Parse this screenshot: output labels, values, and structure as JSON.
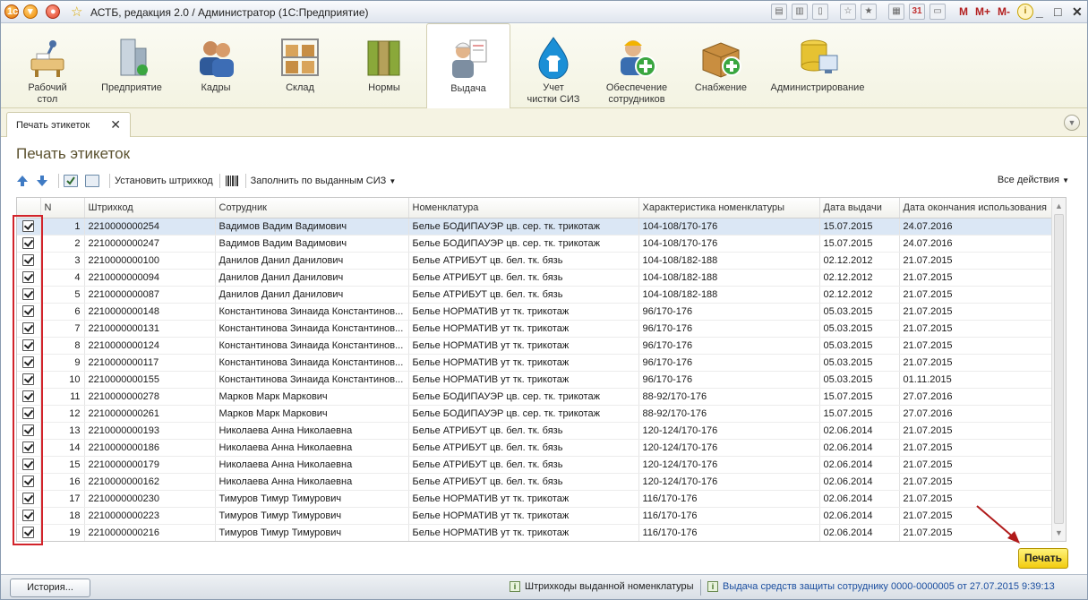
{
  "window": {
    "title": "АСТБ, редакция 2.0 / Администратор  (1С:Предприятие)",
    "toolbar_memory": [
      "M",
      "M+",
      "M-"
    ]
  },
  "sections": [
    {
      "label": "Рабочий\nстол",
      "icon": "desktop-icon"
    },
    {
      "label": "Предприятие",
      "icon": "enterprise-icon"
    },
    {
      "label": "Кадры",
      "icon": "staff-icon"
    },
    {
      "label": "Склад",
      "icon": "warehouse-icon"
    },
    {
      "label": "Нормы",
      "icon": "norms-icon"
    },
    {
      "label": "Выдача",
      "icon": "issue-icon",
      "active": true
    },
    {
      "label": "Учет\nчистки СИЗ",
      "icon": "cleaning-icon"
    },
    {
      "label": "Обеспечение\nсотрудников",
      "icon": "provision-icon"
    },
    {
      "label": "Снабжение",
      "icon": "supply-icon"
    },
    {
      "label": "Администрирование",
      "icon": "admin-icon"
    }
  ],
  "tab": {
    "label": "Печать этикеток"
  },
  "form": {
    "title": "Печать этикеток",
    "toolbar": {
      "set_barcode": "Установить штрихкод",
      "fill_by_issued": "Заполнить по выданным СИЗ",
      "all_actions": "Все действия"
    },
    "columns": [
      "N",
      "Штрихкод",
      "Сотрудник",
      "Номенклатура",
      "Характеристика номенклатуры",
      "Дата выдачи",
      "Дата окончания использования"
    ],
    "rows": [
      {
        "n": "1",
        "barcode": "2210000000254",
        "employee": "Вадимов Вадим Вадимович",
        "item": "Белье БОДИПАУЭР цв. сер. тк. трикотаж",
        "characteristic": "104-108/170-176",
        "issue_date": "15.07.2015",
        "end_date": "24.07.2016",
        "checked": true
      },
      {
        "n": "2",
        "barcode": "2210000000247",
        "employee": "Вадимов Вадим Вадимович",
        "item": "Белье БОДИПАУЭР цв. сер. тк. трикотаж",
        "characteristic": "104-108/170-176",
        "issue_date": "15.07.2015",
        "end_date": "24.07.2016",
        "checked": true
      },
      {
        "n": "3",
        "barcode": "2210000000100",
        "employee": "Данилов Данил Данилович",
        "item": "Белье АТРИБУТ цв. бел. тк. бязь",
        "characteristic": "104-108/182-188",
        "issue_date": "02.12.2012",
        "end_date": "21.07.2015",
        "checked": true
      },
      {
        "n": "4",
        "barcode": "2210000000094",
        "employee": "Данилов Данил Данилович",
        "item": "Белье АТРИБУТ цв. бел. тк. бязь",
        "characteristic": "104-108/182-188",
        "issue_date": "02.12.2012",
        "end_date": "21.07.2015",
        "checked": true
      },
      {
        "n": "5",
        "barcode": "2210000000087",
        "employee": "Данилов Данил Данилович",
        "item": "Белье АТРИБУТ цв. бел. тк. бязь",
        "characteristic": "104-108/182-188",
        "issue_date": "02.12.2012",
        "end_date": "21.07.2015",
        "checked": true
      },
      {
        "n": "6",
        "barcode": "2210000000148",
        "employee": "Константинова Зинаида Константинов...",
        "item": "Белье НОРМАТИВ ут тк. трикотаж",
        "characteristic": "96/170-176",
        "issue_date": "05.03.2015",
        "end_date": "21.07.2015",
        "checked": true
      },
      {
        "n": "7",
        "barcode": "2210000000131",
        "employee": "Константинова Зинаида Константинов...",
        "item": "Белье НОРМАТИВ ут тк. трикотаж",
        "characteristic": "96/170-176",
        "issue_date": "05.03.2015",
        "end_date": "21.07.2015",
        "checked": true
      },
      {
        "n": "8",
        "barcode": "2210000000124",
        "employee": "Константинова Зинаида Константинов...",
        "item": "Белье НОРМАТИВ ут тк. трикотаж",
        "characteristic": "96/170-176",
        "issue_date": "05.03.2015",
        "end_date": "21.07.2015",
        "checked": true
      },
      {
        "n": "9",
        "barcode": "2210000000117",
        "employee": "Константинова Зинаида Константинов...",
        "item": "Белье НОРМАТИВ ут тк. трикотаж",
        "characteristic": "96/170-176",
        "issue_date": "05.03.2015",
        "end_date": "21.07.2015",
        "checked": true
      },
      {
        "n": "10",
        "barcode": "2210000000155",
        "employee": "Константинова Зинаида Константинов...",
        "item": "Белье НОРМАТИВ ут тк. трикотаж",
        "characteristic": "96/170-176",
        "issue_date": "05.03.2015",
        "end_date": "01.11.2015",
        "checked": true
      },
      {
        "n": "11",
        "barcode": "2210000000278",
        "employee": "Марков Марк Маркович",
        "item": "Белье БОДИПАУЭР цв. сер. тк. трикотаж",
        "characteristic": "88-92/170-176",
        "issue_date": "15.07.2015",
        "end_date": "27.07.2016",
        "checked": true
      },
      {
        "n": "12",
        "barcode": "2210000000261",
        "employee": "Марков Марк Маркович",
        "item": "Белье БОДИПАУЭР цв. сер. тк. трикотаж",
        "characteristic": "88-92/170-176",
        "issue_date": "15.07.2015",
        "end_date": "27.07.2016",
        "checked": true
      },
      {
        "n": "13",
        "barcode": "2210000000193",
        "employee": "Николаева Анна Николаевна",
        "item": "Белье АТРИБУТ цв. бел. тк. бязь",
        "characteristic": "120-124/170-176",
        "issue_date": "02.06.2014",
        "end_date": "21.07.2015",
        "checked": true
      },
      {
        "n": "14",
        "barcode": "2210000000186",
        "employee": "Николаева Анна Николаевна",
        "item": "Белье АТРИБУТ цв. бел. тк. бязь",
        "characteristic": "120-124/170-176",
        "issue_date": "02.06.2014",
        "end_date": "21.07.2015",
        "checked": true
      },
      {
        "n": "15",
        "barcode": "2210000000179",
        "employee": "Николаева Анна Николаевна",
        "item": "Белье АТРИБУТ цв. бел. тк. бязь",
        "characteristic": "120-124/170-176",
        "issue_date": "02.06.2014",
        "end_date": "21.07.2015",
        "checked": true
      },
      {
        "n": "16",
        "barcode": "2210000000162",
        "employee": "Николаева Анна Николаевна",
        "item": "Белье АТРИБУТ цв. бел. тк. бязь",
        "characteristic": "120-124/170-176",
        "issue_date": "02.06.2014",
        "end_date": "21.07.2015",
        "checked": true
      },
      {
        "n": "17",
        "barcode": "2210000000230",
        "employee": "Тимуров Тимур Тимурович",
        "item": "Белье НОРМАТИВ ут тк. трикотаж",
        "characteristic": "116/170-176",
        "issue_date": "02.06.2014",
        "end_date": "21.07.2015",
        "checked": true
      },
      {
        "n": "18",
        "barcode": "2210000000223",
        "employee": "Тимуров Тимур Тимурович",
        "item": "Белье НОРМАТИВ ут тк. трикотаж",
        "characteristic": "116/170-176",
        "issue_date": "02.06.2014",
        "end_date": "21.07.2015",
        "checked": true
      },
      {
        "n": "19",
        "barcode": "2210000000216",
        "employee": "Тимуров Тимур Тимурович",
        "item": "Белье НОРМАТИВ ут тк. трикотаж",
        "characteristic": "116/170-176",
        "issue_date": "02.06.2014",
        "end_date": "21.07.2015",
        "checked": true
      }
    ],
    "print_button": "Печать"
  },
  "statusbar": {
    "history": "История...",
    "item1": "Штрихкоды выданной номенклатуры",
    "item2": "Выдача средств защиты сотруднику 0000-0000005 от 27.07.2015 9:39:13"
  },
  "colors": {
    "accent_yellow": "#f2cc10",
    "highlight_red": "#d2232a",
    "selected_row": "#dbe7f5",
    "title_brown": "#5c5230"
  }
}
